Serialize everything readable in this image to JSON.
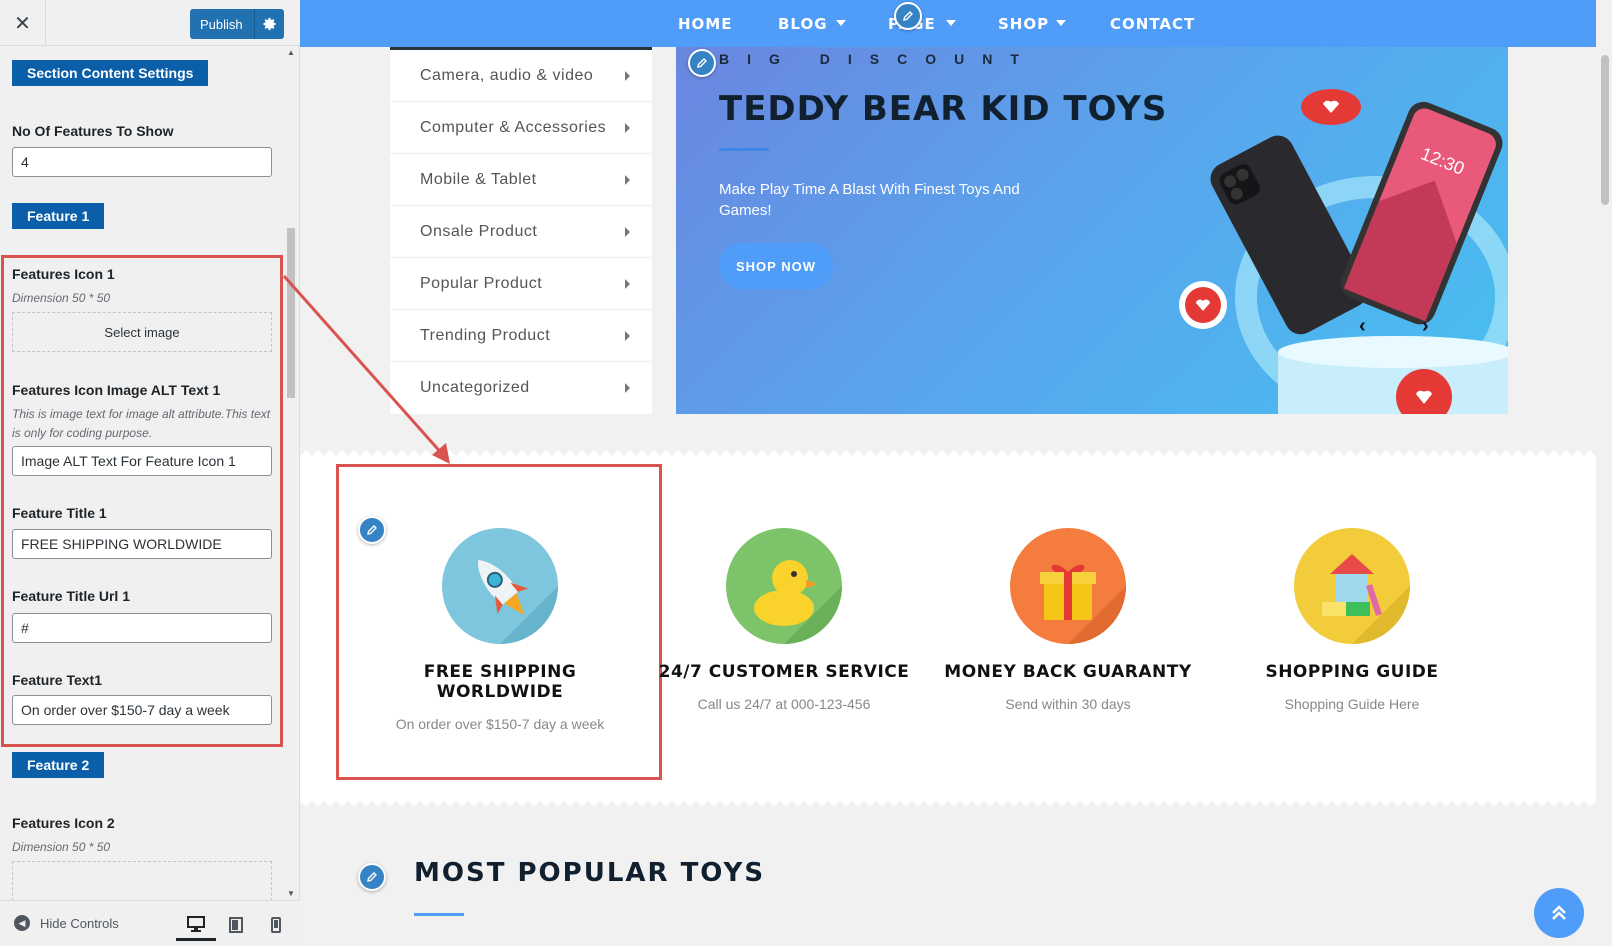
{
  "sidebar": {
    "publish_label": "Publish",
    "section_title": "Section Content Settings",
    "no_features_label": "No Of Features To Show",
    "no_features_value": "4",
    "feature1": {
      "badge": "Feature 1",
      "icon_label": "Features Icon 1",
      "icon_dimension": "Dimension 50 * 50",
      "select_image": "Select image",
      "alt_label": "Features Icon Image ALT Text 1",
      "alt_desc": "This is image text for image alt attribute.This text is only for coding purpose.",
      "alt_value": "Image ALT Text For Feature Icon 1",
      "title_label": "Feature Title 1",
      "title_value": "FREE SHIPPING WORLDWIDE",
      "url_label": "Feature Title Url 1",
      "url_value": "#",
      "text_label": "Feature Text1",
      "text_value": "On order over $150-7 day a week"
    },
    "feature2": {
      "badge": "Feature 2",
      "icon_label": "Features Icon 2",
      "icon_dimension": "Dimension 50 * 50"
    },
    "hide_controls": "Hide Controls"
  },
  "nav": {
    "items": [
      "HOME",
      "BLOG",
      "PAGE",
      "SHOP",
      "CONTACT"
    ]
  },
  "categories": [
    "Camera, audio & video",
    "Computer & Accessories",
    "Mobile & Tablet",
    "Onsale Product",
    "Popular Product",
    "Trending Product",
    "Uncategorized"
  ],
  "hero": {
    "subtitle": "BIG DISCOUNT",
    "title": "TEDDY BEAR KID TOYS",
    "text": "Make Play Time A Blast With Finest Toys And Games!",
    "button": "SHOP NOW",
    "screen_time": "12:30"
  },
  "features": [
    {
      "title": "FREE SHIPPING WORLDWIDE",
      "text": "On order over $150-7 day a week",
      "icon": "rocket-icon",
      "color": "#7ec6dd"
    },
    {
      "title": "24/7 CUSTOMER SERVICE",
      "text": "Call us 24/7 at 000-123-456",
      "icon": "duck-icon",
      "color": "#7cc36a"
    },
    {
      "title": "MONEY BACK GUARANTY",
      "text": "Send within 30 days",
      "icon": "gift-icon",
      "color": "#f57c3f"
    },
    {
      "title": "SHOPPING GUIDE",
      "text": "Shopping Guide Here",
      "icon": "toy-blocks-icon",
      "color": "#f2cc3a"
    }
  ],
  "popular": {
    "title": "MOST POPULAR TOYS"
  },
  "colors": {
    "accent": "#4f9cf9",
    "wp_blue": "#2271b1",
    "highlight": "#d9534f"
  }
}
